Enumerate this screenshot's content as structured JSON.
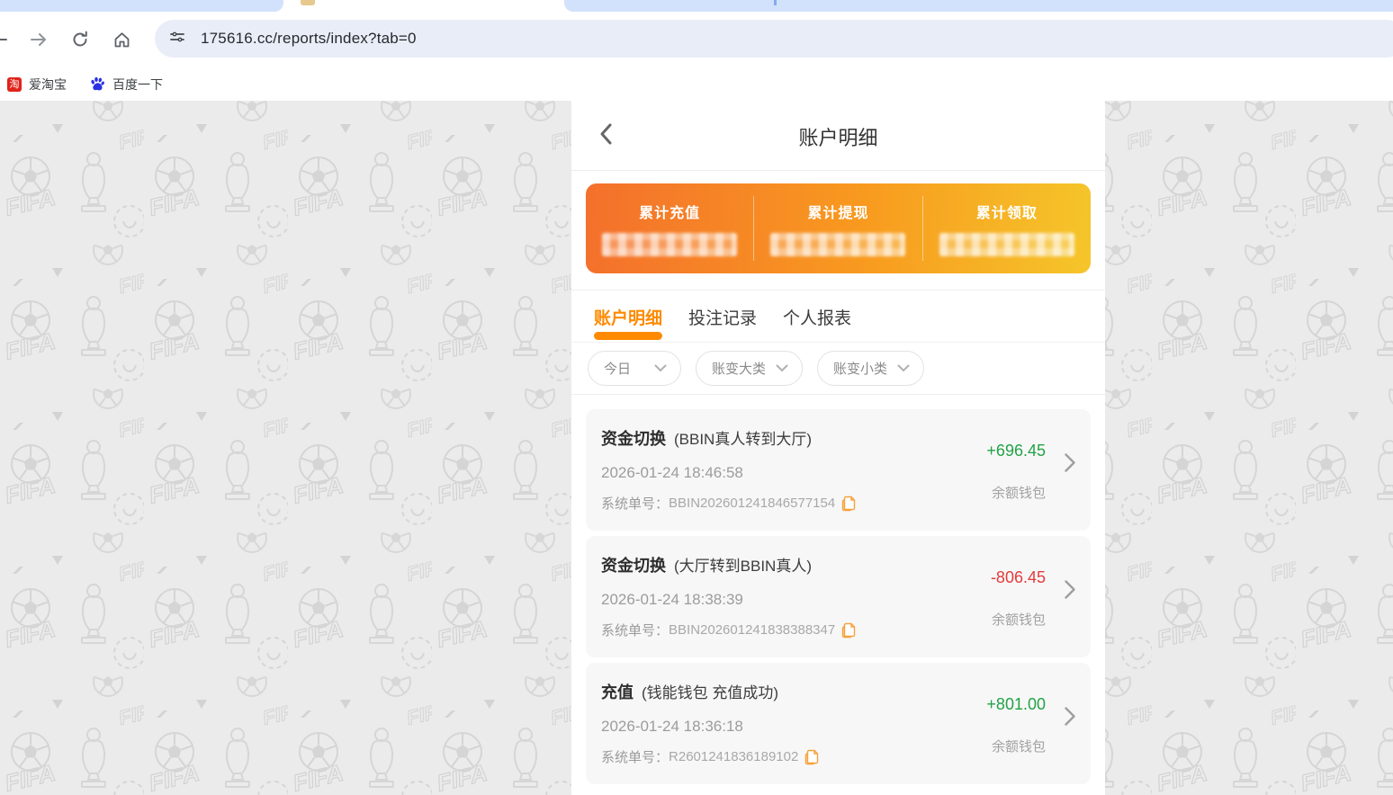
{
  "browser": {
    "url": "175616.cc/reports/index?tab=0",
    "bookmarks": [
      {
        "label": "爱淘宝",
        "icon_glyph": "淘"
      },
      {
        "label": "百度一下"
      }
    ]
  },
  "page": {
    "header": {
      "title": "账户明细"
    },
    "summary": {
      "items": [
        {
          "label": "累计充值",
          "value_masked": true
        },
        {
          "label": "累计提现",
          "value_masked": true
        },
        {
          "label": "累计领取",
          "value_masked": true
        }
      ]
    },
    "tabs": [
      {
        "label": "账户明细",
        "active": true
      },
      {
        "label": "投注记录",
        "active": false
      },
      {
        "label": "个人报表",
        "active": false
      }
    ],
    "filters": [
      {
        "label": "今日"
      },
      {
        "label": "账变大类"
      },
      {
        "label": "账变小类"
      }
    ],
    "records": [
      {
        "type": "资金切换",
        "note": "(BBIN真人转到大厅)",
        "time": "2026-01-24 18:46:58",
        "order_label": "系统单号：",
        "order_no": "BBIN202601241846577154",
        "amount": "+696.45",
        "wallet": "余额钱包"
      },
      {
        "type": "资金切换",
        "note": "(大厅转到BBIN真人)",
        "time": "2026-01-24 18:38:39",
        "order_label": "系统单号：",
        "order_no": "BBIN202601241838388347",
        "amount": "-806.45",
        "wallet": "余额钱包"
      },
      {
        "type": "充值",
        "note": "(钱能钱包 充值成功)",
        "time": "2026-01-24 18:36:18",
        "order_label": "系统单号：",
        "order_no": "R2601241836189102",
        "amount": "+801.00",
        "wallet": "余额钱包"
      }
    ]
  },
  "colors": {
    "accent_orange": "#ff8a00",
    "card_gradient_start": "#f4702c",
    "card_gradient_end": "#f5c52a",
    "credit_green": "#22a245",
    "debit_red": "#e43b3b",
    "tabstrip_blue": "#d3e2fc",
    "omnibox_bg": "#e9edf8"
  }
}
